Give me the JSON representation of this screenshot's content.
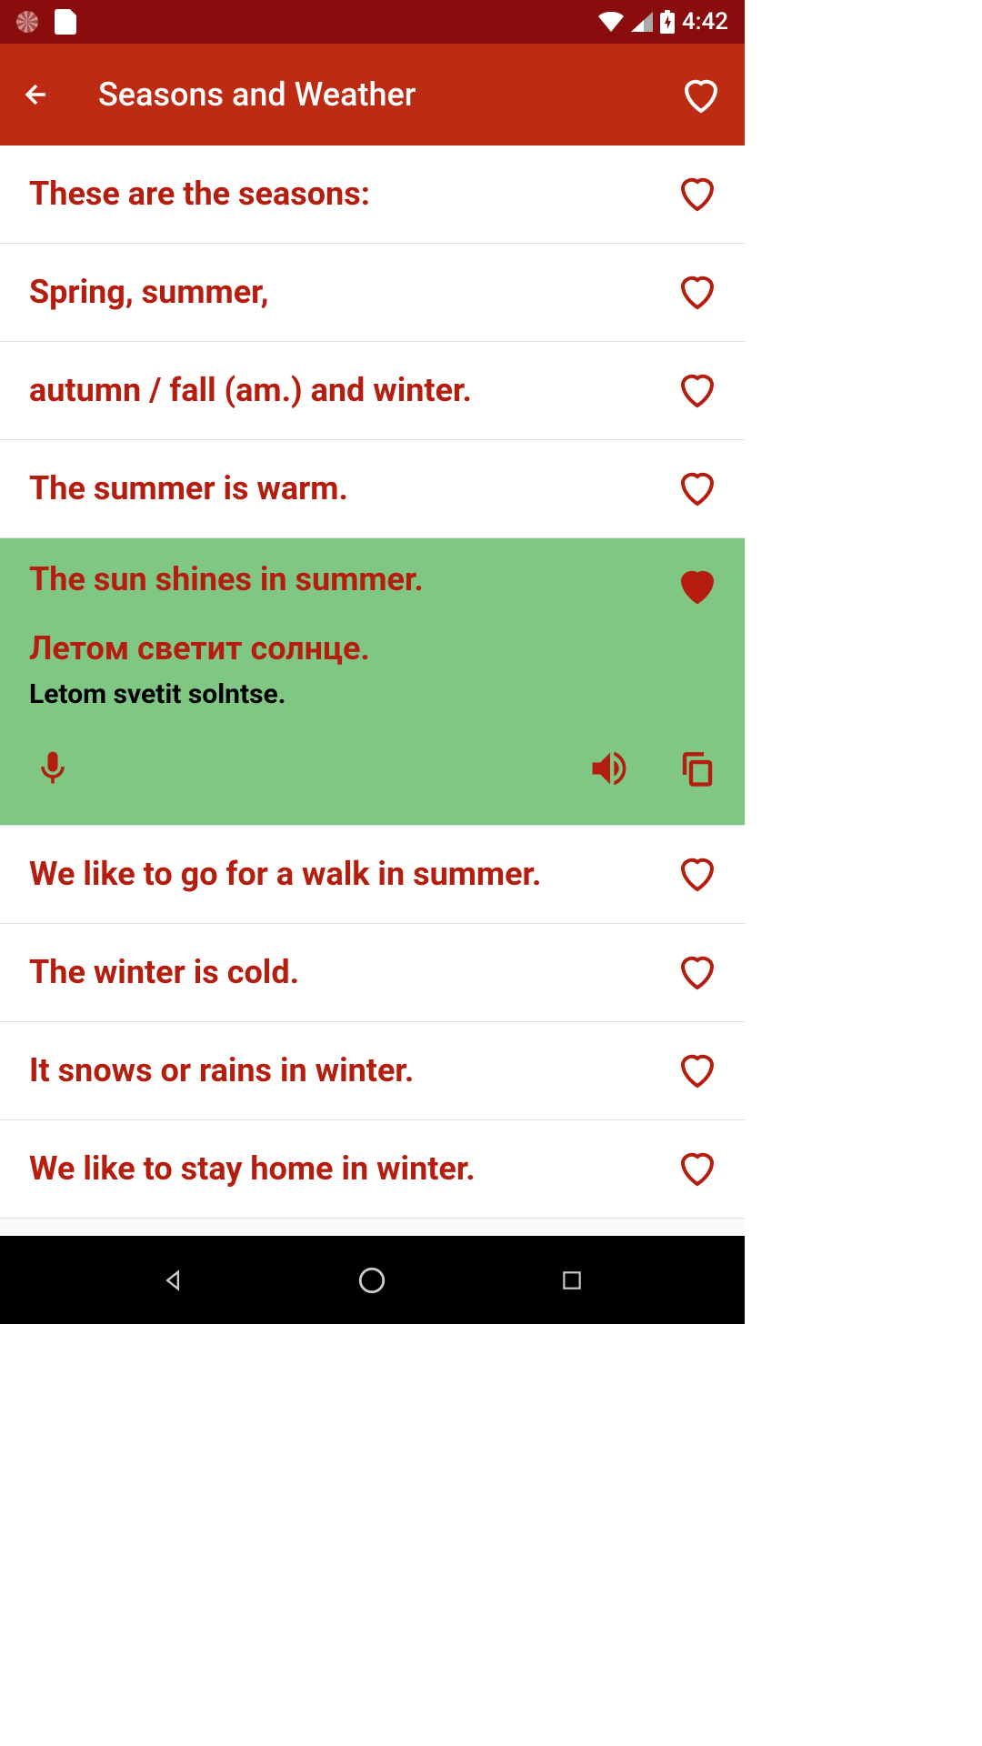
{
  "statusBar": {
    "time": "4:42"
  },
  "appBar": {
    "title": "Seasons and Weather"
  },
  "phrases": [
    {
      "english": "These are the seasons:",
      "expanded": false,
      "favorited": false
    },
    {
      "english": "Spring, summer,",
      "expanded": false,
      "favorited": false
    },
    {
      "english": "autumn / fall (am.) and winter.",
      "expanded": false,
      "favorited": false
    },
    {
      "english": "The summer is warm.",
      "expanded": false,
      "favorited": false
    },
    {
      "english": "The sun shines in summer.",
      "expanded": true,
      "favorited": true,
      "target": "Летом светит солнце.",
      "transliteration": "Letom svetit solntse."
    },
    {
      "english": "We like to go for a walk in summer.",
      "expanded": false,
      "favorited": false
    },
    {
      "english": "The winter is cold.",
      "expanded": false,
      "favorited": false
    },
    {
      "english": "It snows or rains in winter.",
      "expanded": false,
      "favorited": false
    },
    {
      "english": "We like to stay home in winter.",
      "expanded": false,
      "favorited": false
    }
  ],
  "colors": {
    "statusBar": "#8a0d0d",
    "appBar": "#bd2c12",
    "text": "#b51e0e",
    "expandedBg": "#81c784"
  }
}
